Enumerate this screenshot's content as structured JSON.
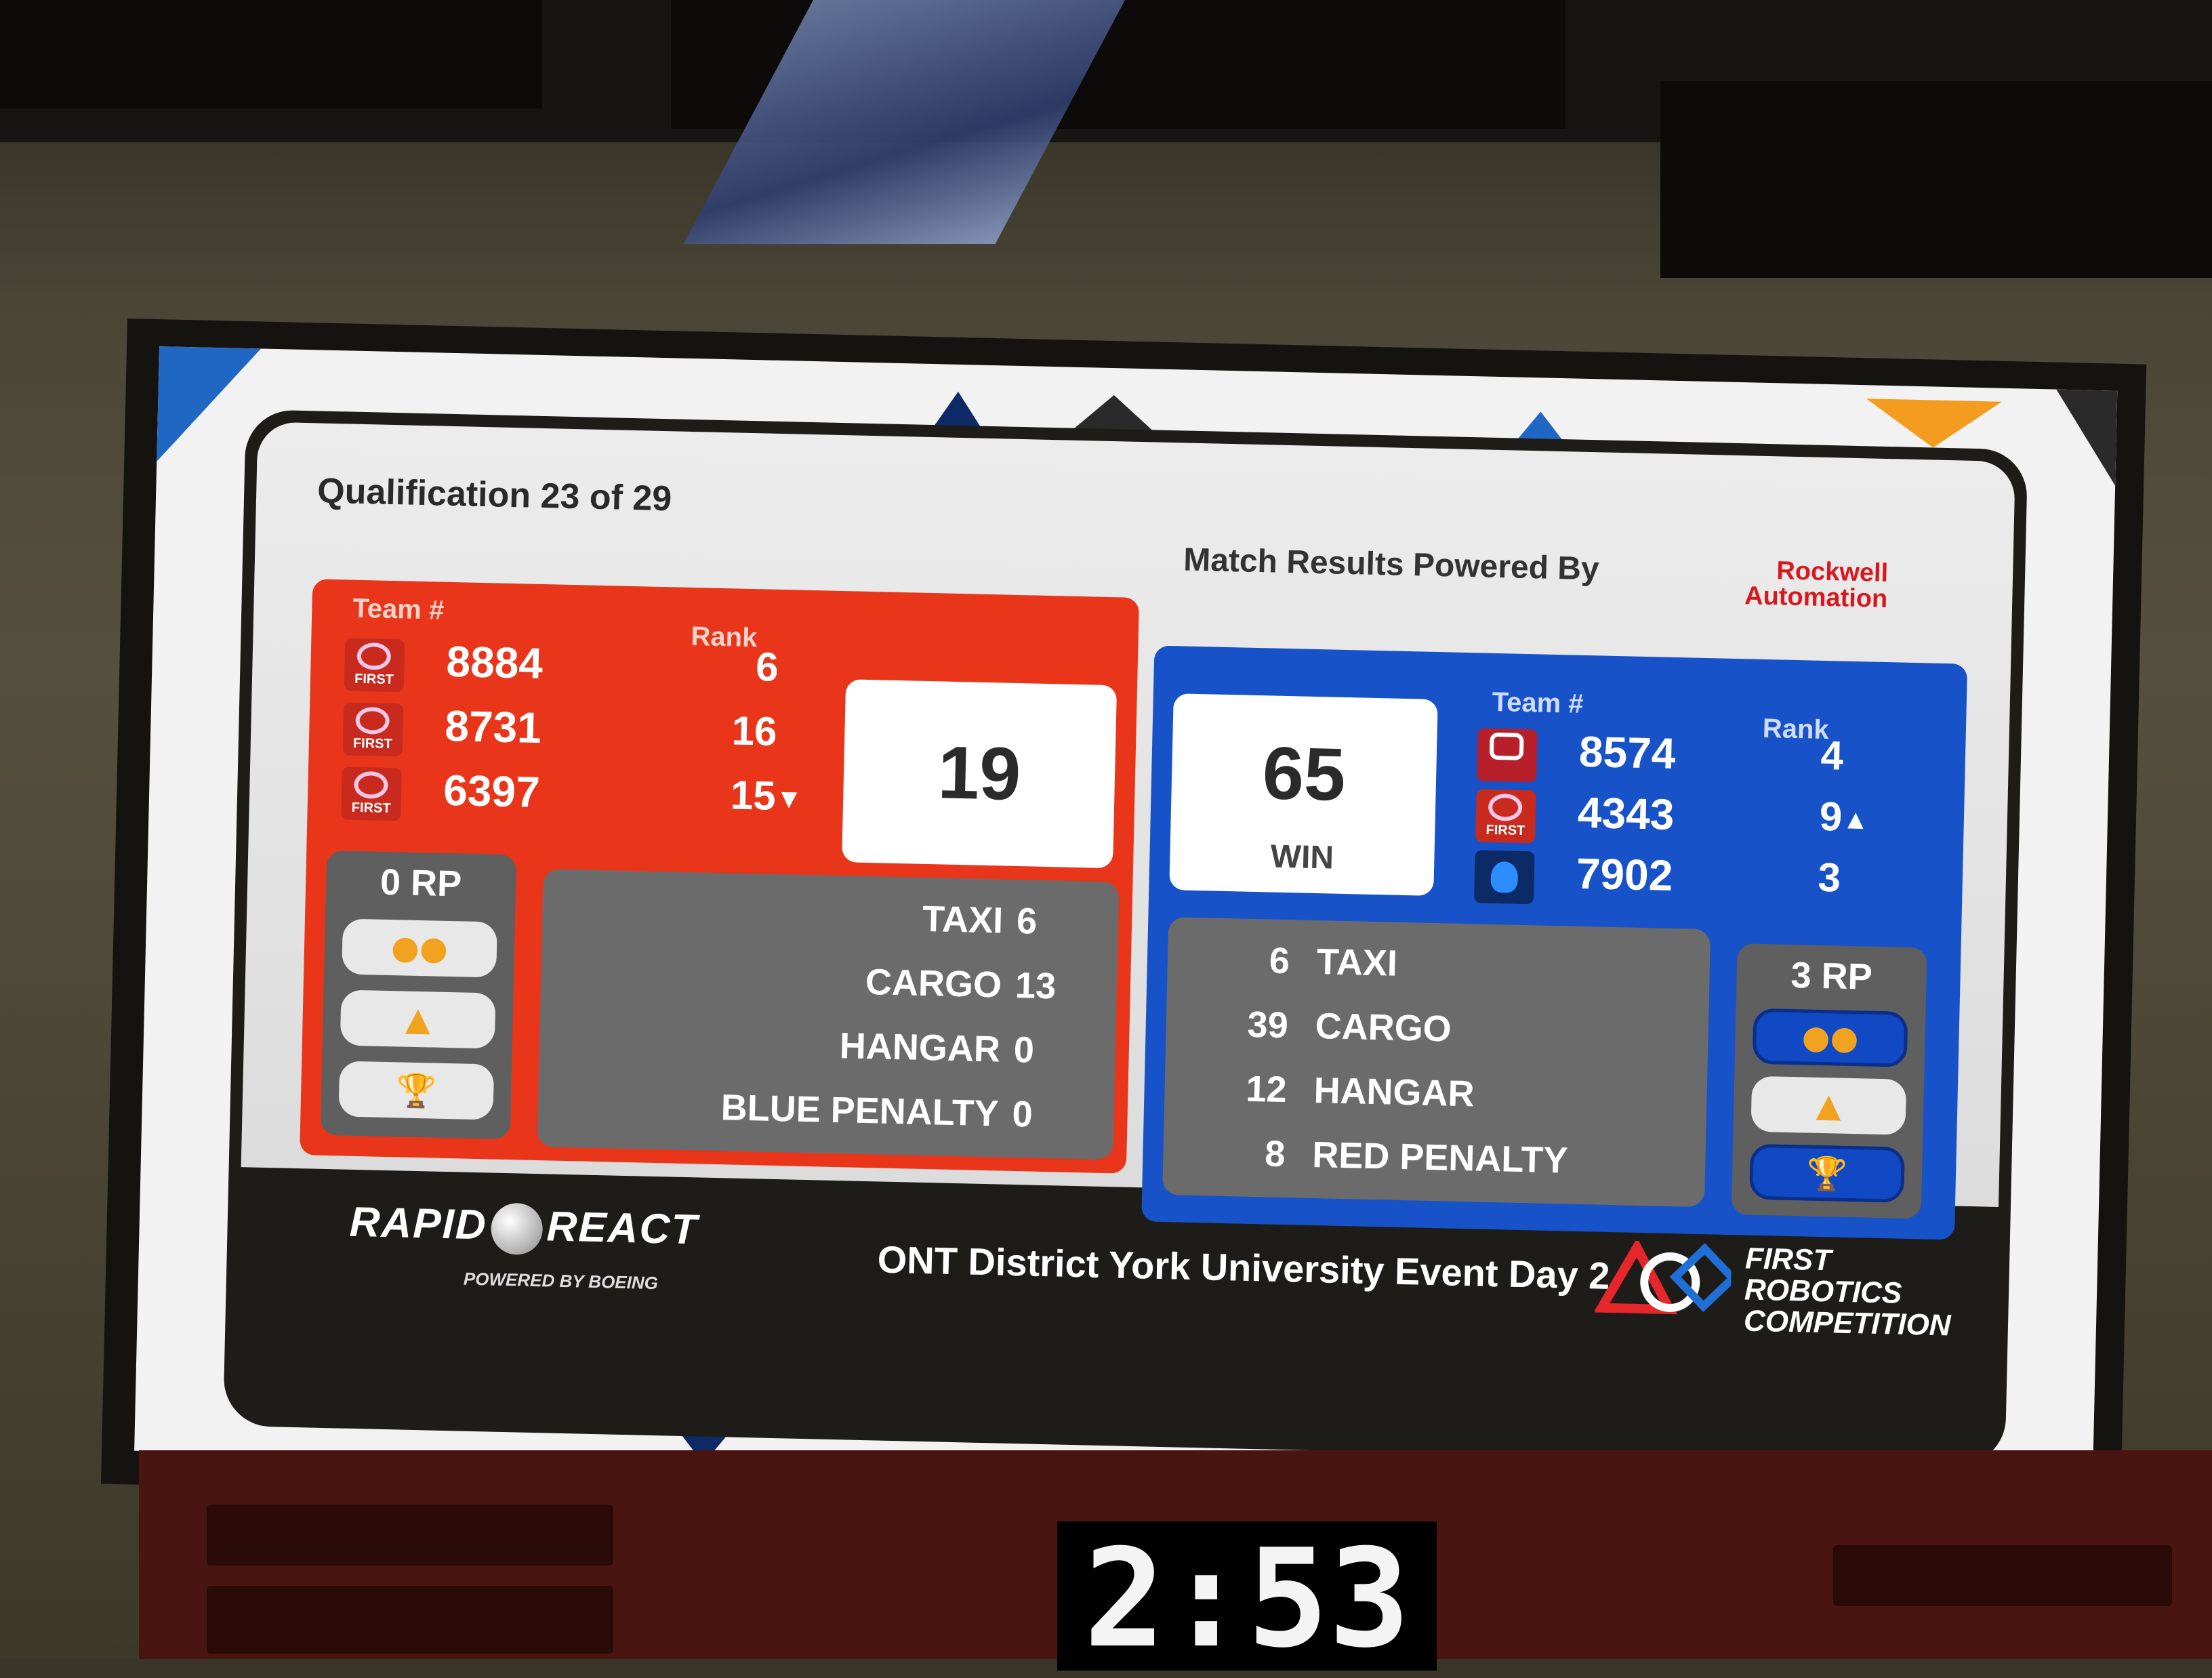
{
  "match": {
    "title": "Qualification 23 of 29",
    "powered_by": "Match Results Powered By",
    "sponsor_line1": "Rockwell",
    "sponsor_line2": "Automation"
  },
  "red": {
    "team_header": "Team #",
    "rank_header": "Rank",
    "teams": [
      {
        "number": "8884",
        "rank": "6",
        "rank_change": ""
      },
      {
        "number": "8731",
        "rank": "16",
        "rank_change": ""
      },
      {
        "number": "6397",
        "rank": "15",
        "rank_change": "▼"
      }
    ],
    "score": "19",
    "rp_label": "0 RP",
    "breakdown": [
      {
        "label": "TAXI",
        "value": "6"
      },
      {
        "label": "CARGO",
        "value": "13"
      },
      {
        "label": "HANGAR",
        "value": "0"
      },
      {
        "label": "BLUE PENALTY",
        "value": "0"
      }
    ],
    "logo_text": "FIRST"
  },
  "blue": {
    "team_header": "Team #",
    "rank_header": "Rank",
    "teams": [
      {
        "number": "8574",
        "rank": "4",
        "rank_change": ""
      },
      {
        "number": "4343",
        "rank": "9",
        "rank_change": "▲"
      },
      {
        "number": "7902",
        "rank": "3",
        "rank_change": ""
      }
    ],
    "score": "65",
    "result": "WIN",
    "rp_label": "3 RP",
    "breakdown": [
      {
        "value": "6",
        "label": "TAXI"
      },
      {
        "value": "39",
        "label": "CARGO"
      },
      {
        "value": "12",
        "label": "HANGAR"
      },
      {
        "value": "8",
        "label": "RED PENALTY"
      }
    ],
    "logo_text": "FIRST"
  },
  "footer": {
    "game_part1": "RAPID",
    "game_part2": "REACT",
    "game_sponsor": "POWERED BY  BOEING",
    "event": "ONT District York University Event Day 2",
    "frc_line1": "FIRST",
    "frc_line2": "ROBOTICS",
    "frc_line3": "COMPETITION"
  },
  "clock": {
    "time": "2:53"
  },
  "colors": {
    "red_alliance": "#e9361b",
    "blue_alliance": "#1752c8",
    "rp_icon": "#f1a31f"
  },
  "icons": {
    "rp_cargo": "cargo-balls-icon",
    "rp_hangar": "hangar-icon",
    "rp_win": "trophy-icon"
  }
}
